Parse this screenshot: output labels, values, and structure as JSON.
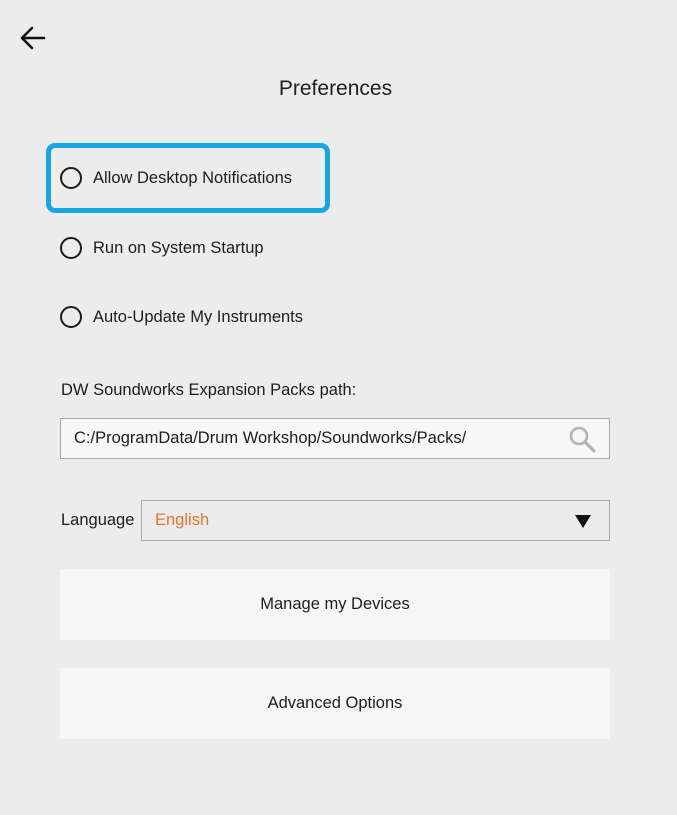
{
  "header": {
    "back_icon": "arrow-left-icon",
    "title": "Preferences"
  },
  "options": [
    {
      "label": "Allow Desktop Notifications",
      "checked": false,
      "focused": true
    },
    {
      "label": "Run on System Startup",
      "checked": false,
      "focused": false
    },
    {
      "label": "Auto-Update My Instruments",
      "checked": false,
      "focused": false
    }
  ],
  "expansion_path": {
    "label": "DW Soundworks Expansion Packs path:",
    "value": "C:/ProgramData/Drum Workshop/Soundworks/Packs/",
    "search_icon": "search-icon"
  },
  "language": {
    "label": "Language",
    "selected": "English",
    "dropdown_icon": "chevron-down-icon"
  },
  "buttons": {
    "manage_devices": "Manage my Devices",
    "advanced_options": "Advanced Options"
  },
  "colors": {
    "background": "#ececec",
    "focus_ring": "#16a6e0",
    "accent_text": "#e8732a",
    "button_bg": "#f6f6f6"
  }
}
